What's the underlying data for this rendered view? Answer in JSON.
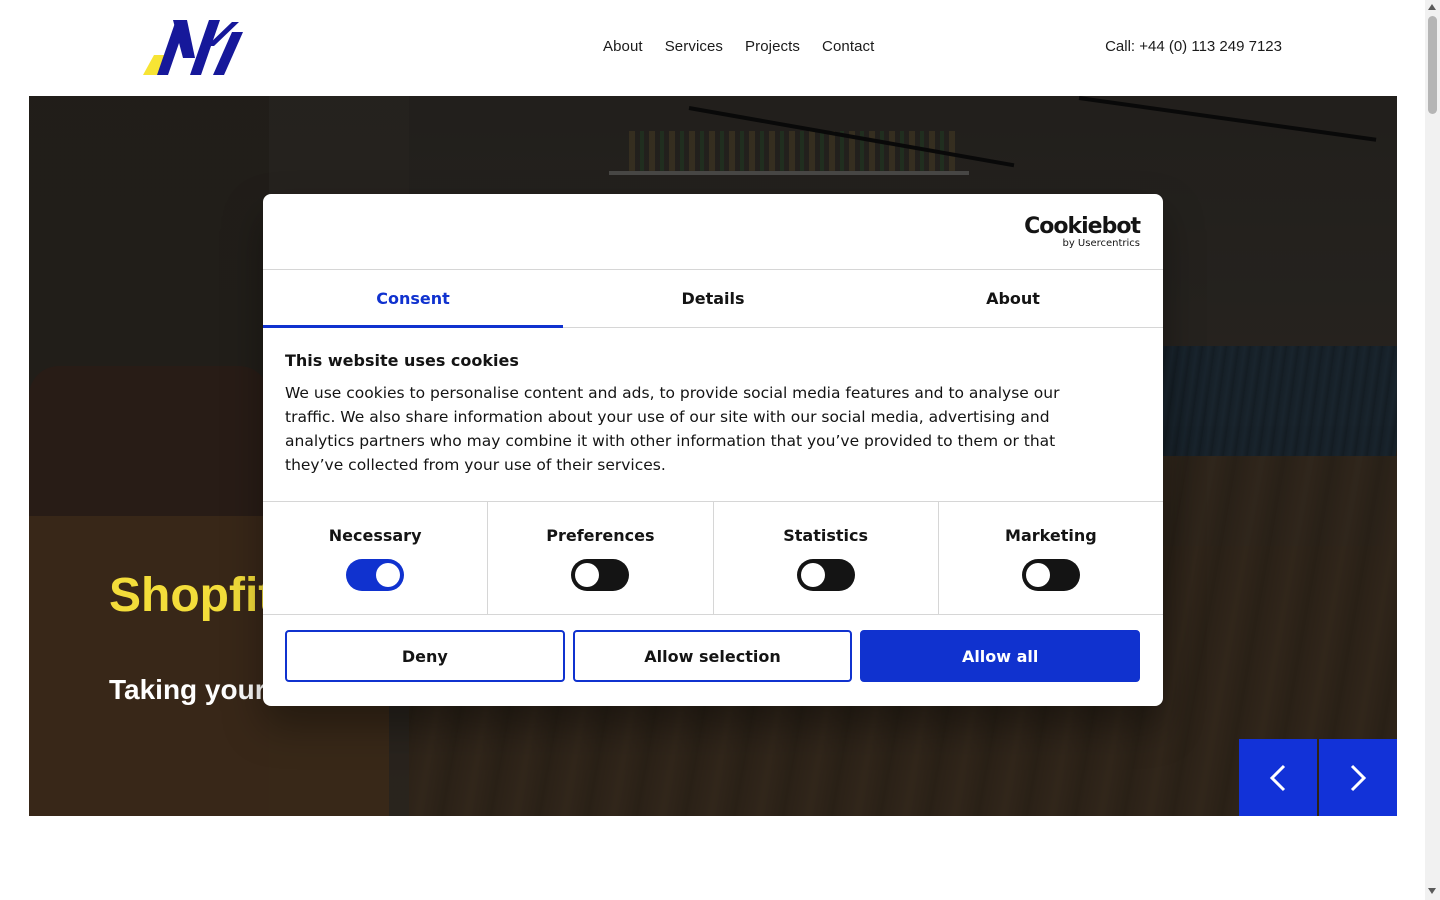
{
  "header": {
    "nav": [
      "About",
      "Services",
      "Projects",
      "Contact"
    ],
    "phone": "Call: +44 (0) 113 249 7123"
  },
  "hero": {
    "title": "Shopfit",
    "subtitle": "Taking your",
    "prev_icon": "chevron-left-icon",
    "next_icon": "chevron-right-icon"
  },
  "cookie": {
    "brand": "Cookiebot",
    "brand_by": "by Usercentrics",
    "tabs": [
      "Consent",
      "Details",
      "About"
    ],
    "active_tab": "Consent",
    "heading": "This website uses cookies",
    "text": "We use cookies to personalise content and ads, to provide social media features and to analyse our traffic. We also share information about your use of our site with our social media, advertising and analytics partners who may combine it with other information that you’ve provided to them or that they’ve collected from your use of their services.",
    "categories": [
      {
        "label": "Necessary",
        "on": true
      },
      {
        "label": "Preferences",
        "on": false
      },
      {
        "label": "Statistics",
        "on": false
      },
      {
        "label": "Marketing",
        "on": false
      }
    ],
    "buttons": {
      "deny": "Deny",
      "allow_selection": "Allow selection",
      "allow_all": "Allow all"
    }
  },
  "colors": {
    "brand_blue": "#1032cf",
    "slider_blue": "#1232d8",
    "hero_yellow": "#f3dd3a",
    "logo_yellow": "#f7e434",
    "logo_navy": "#16189a"
  }
}
